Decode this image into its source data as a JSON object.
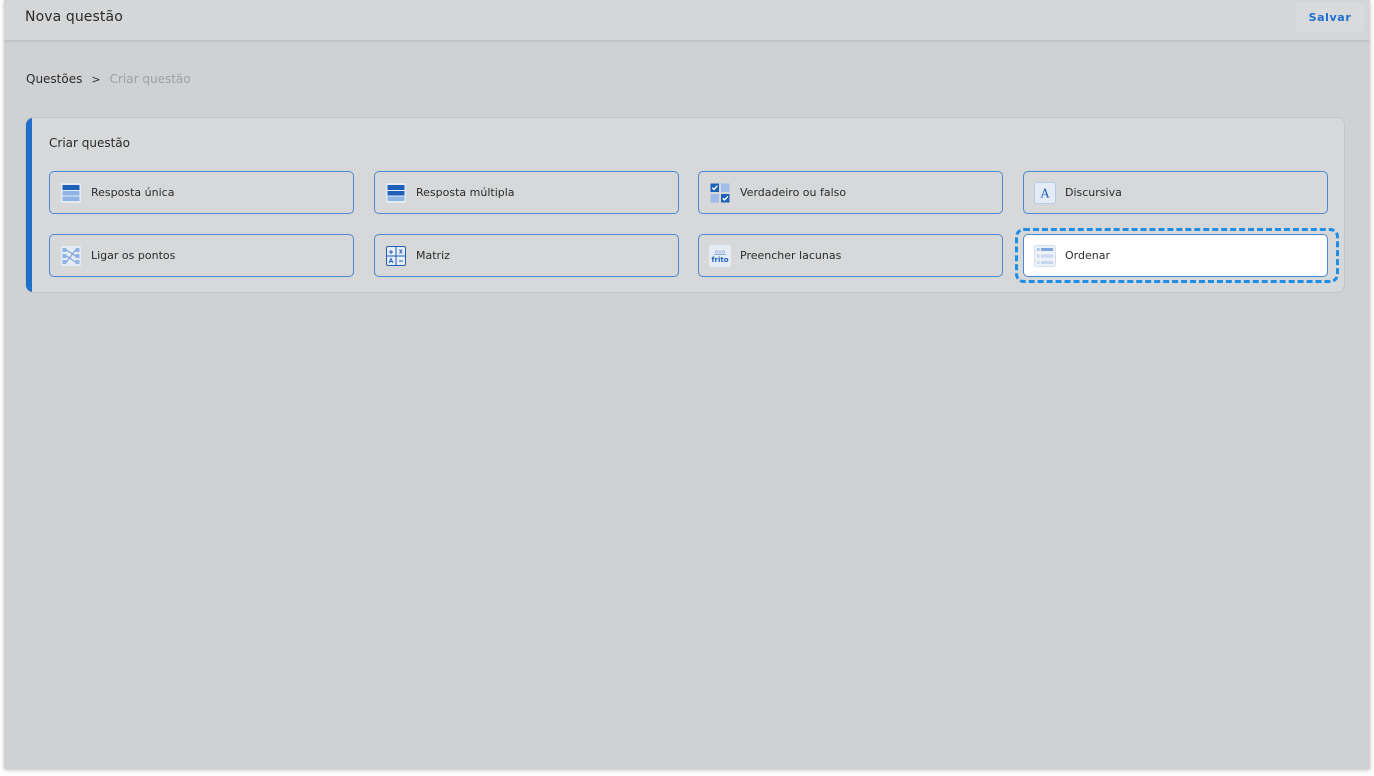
{
  "header": {
    "title": "Nova questão",
    "save_label": "Salvar"
  },
  "breadcrumb": {
    "root": "Questões",
    "separator": ">",
    "current": "Criar questão"
  },
  "panel": {
    "title": "Criar questão",
    "options": [
      {
        "label": "Resposta única",
        "icon": "single-answer-icon"
      },
      {
        "label": "Resposta múltipla",
        "icon": "multiple-answer-icon"
      },
      {
        "label": "Verdadeiro ou falso",
        "icon": "true-false-icon"
      },
      {
        "label": "Discursiva",
        "icon": "discursive-icon",
        "icon_text": "A"
      },
      {
        "label": "Ligar os pontos",
        "icon": "connect-dots-icon"
      },
      {
        "label": "Matriz",
        "icon": "matrix-icon"
      },
      {
        "label": "Preencher lacunas",
        "icon": "fill-blanks-icon",
        "icon_text_top": "ovo",
        "icon_text_bottom": "frito"
      },
      {
        "label": "Ordenar",
        "icon": "ordering-icon",
        "selected": true
      }
    ]
  },
  "colors": {
    "accent": "#1f6ec9",
    "focus": "#1f8ee6",
    "background": "#d0d1d3"
  }
}
